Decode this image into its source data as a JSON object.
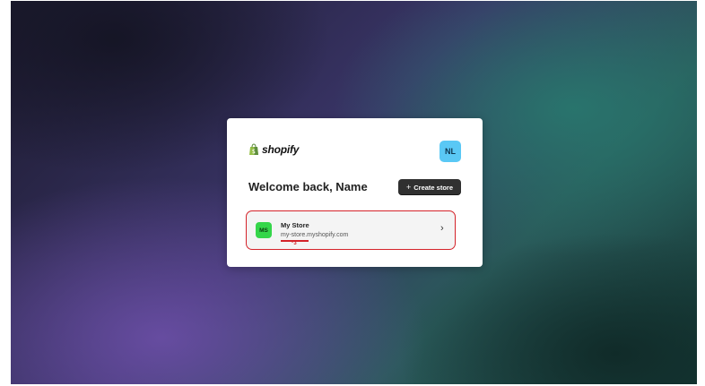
{
  "brand": {
    "name": "shopify",
    "logo_icon": "shopify-bag-icon",
    "logo_color": "#95bf47"
  },
  "user": {
    "initials": "NL",
    "avatar_color": "#5ac8f5"
  },
  "header": {
    "welcome_text": "Welcome back, Name"
  },
  "actions": {
    "create_store_label": "Create store",
    "create_store_icon": "plus-icon"
  },
  "stores": [
    {
      "initials": "MS",
      "name": "My Store",
      "domain": "my-store.myshopify.com",
      "avatar_color": "#35d64a",
      "chevron": "›"
    }
  ],
  "annotation": {
    "label": "*3",
    "highlight_color": "#d4232a"
  }
}
